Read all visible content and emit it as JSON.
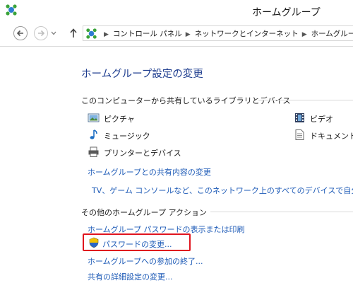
{
  "window": {
    "title": "ホームグループ"
  },
  "navigation": {
    "breadcrumbs": [
      "コントロール パネル",
      "ネットワークとインターネット",
      "ホームグループ"
    ]
  },
  "main": {
    "page_title": "ホームグループ設定の変更",
    "shared_section": {
      "heading": "このコンピューターから共有しているライブラリとデバイス",
      "items": [
        {
          "label": "ピクチャ",
          "icon": "pictures-icon"
        },
        {
          "label": "ビデオ",
          "icon": "videos-icon"
        },
        {
          "label": "ミュージック",
          "icon": "music-icon"
        },
        {
          "label": "ドキュメント",
          "icon": "documents-icon"
        },
        {
          "label": "プリンターとデバイス",
          "icon": "printer-icon"
        }
      ],
      "links": [
        "ホームグループとの共有内容の変更",
        "TV、ゲーム コンソールなど、このネットワーク上のすべてのデバイスで自分の共有コ"
      ]
    },
    "actions_section": {
      "heading": "その他のホームグループ アクション",
      "links": [
        "ホームグループ パスワードの表示または印刷",
        "パスワードの変更...",
        "ホームグループへの参加の終了...",
        "共有の詳細設定の変更..."
      ]
    }
  },
  "colors": {
    "link": "#1e5bb7",
    "title": "#1e3d8f",
    "highlight": "#e0141e"
  }
}
